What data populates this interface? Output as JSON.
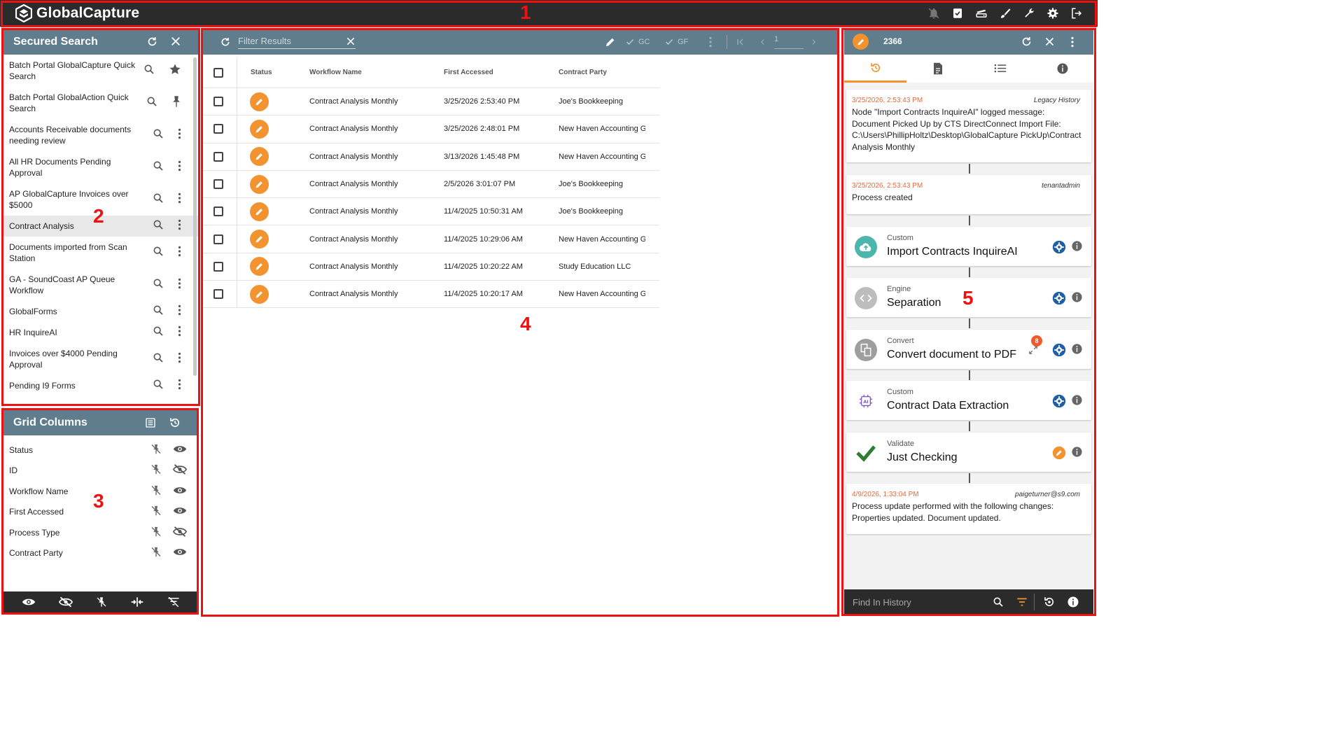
{
  "app": {
    "name": "GlobalCapture"
  },
  "callouts": [
    "1",
    "2",
    "3",
    "4",
    "5"
  ],
  "colors": {
    "topbar": "#2b2b2b",
    "header": "#5f7d8d",
    "accent": "#f2932f",
    "annotation": "#ee1111",
    "date": "#e56a3b"
  },
  "secured_search": {
    "title": "Secured Search",
    "items": [
      {
        "label": "Batch Portal GlobalCapture Quick Search",
        "action": "star-icon"
      },
      {
        "label": "Batch Portal GlobalAction Quick Search",
        "action": "pin-icon"
      },
      {
        "label": "Accounts Receivable documents needing review",
        "action": "more-icon"
      },
      {
        "label": "All HR Documents Pending Approval",
        "action": "more-icon"
      },
      {
        "label": "AP GlobalCapture Invoices over $5000",
        "action": "more-icon"
      },
      {
        "label": "Contract Analysis",
        "action": "more-icon",
        "selected": true
      },
      {
        "label": "Documents imported from Scan Station",
        "action": "more-icon"
      },
      {
        "label": "GA - SoundCoast AP Queue Workflow",
        "action": "more-icon"
      },
      {
        "label": "GlobalForms",
        "action": "more-icon"
      },
      {
        "label": "HR InquireAI",
        "action": "more-icon"
      },
      {
        "label": "Invoices over $4000 Pending Approval",
        "action": "more-icon"
      },
      {
        "label": "Pending I9 Forms",
        "action": "more-icon"
      }
    ]
  },
  "grid_columns": {
    "title": "Grid Columns",
    "columns": [
      {
        "label": "Status",
        "visible": true
      },
      {
        "label": "ID",
        "visible": false
      },
      {
        "label": "Workflow Name",
        "visible": true
      },
      {
        "label": "First Accessed",
        "visible": true
      },
      {
        "label": "Process Type",
        "visible": false
      },
      {
        "label": "Contract Party",
        "visible": true
      }
    ]
  },
  "grid": {
    "filter_placeholder": "Filter Results",
    "gc_label": "GC",
    "gf_label": "GF",
    "page": "1",
    "headers": {
      "status": "Status",
      "workflow": "Workflow Name",
      "first_accessed": "First Accessed",
      "party": "Contract Party"
    },
    "rows": [
      {
        "workflow": "Contract Analysis Monthly",
        "first_accessed": "3/25/2026 2:53:40 PM",
        "party": "Joe's Bookkeeping"
      },
      {
        "workflow": "Contract Analysis Monthly",
        "first_accessed": "3/25/2026 2:48:01 PM",
        "party": "New Haven Accounting Gr"
      },
      {
        "workflow": "Contract Analysis Monthly",
        "first_accessed": "3/13/2026 1:45:48 PM",
        "party": "New Haven Accounting Gr"
      },
      {
        "workflow": "Contract Analysis Monthly",
        "first_accessed": "2/5/2026 3:01:07 PM",
        "party": "Joe's Bookkeeping"
      },
      {
        "workflow": "Contract Analysis Monthly",
        "first_accessed": "11/4/2025 10:50:31 AM",
        "party": "Joe's Bookkeeping"
      },
      {
        "workflow": "Contract Analysis Monthly",
        "first_accessed": "11/4/2025 10:29:06 AM",
        "party": "New Haven Accounting Gr"
      },
      {
        "workflow": "Contract Analysis Monthly",
        "first_accessed": "11/4/2025 10:20:22 AM",
        "party": "Study Education LLC"
      },
      {
        "workflow": "Contract Analysis Monthly",
        "first_accessed": "11/4/2025 10:20:17 AM",
        "party": "New Haven Accounting Gr"
      }
    ]
  },
  "detail": {
    "id": "2366",
    "history": [
      {
        "date": "3/25/2026, 2:53:43 PM",
        "user": "Legacy History",
        "message": "Node \"Import Contracts InquireAI\" logged message: Document Picked Up by CTS DirectConnect Import File: C:\\Users\\PhillipHoltz\\Desktop\\GlobalCapture PickUp\\Contract Analysis Monthly"
      },
      {
        "date": "3/25/2026, 2:53:43 PM",
        "user": "tenantadmin",
        "message": "Process created"
      }
    ],
    "nodes": [
      {
        "type": "Custom",
        "name": "Import Contracts InquireAI",
        "icon": "cloud-upload-icon",
        "color": "#4db6ac"
      },
      {
        "type": "Engine",
        "name": "Separation",
        "icon": "code-icon",
        "color": "#bdbdbd"
      },
      {
        "type": "Convert",
        "name": "Convert document to PDF",
        "icon": "convert-doc-icon",
        "color": "#9e9e9e",
        "badge": "8"
      },
      {
        "type": "Custom",
        "name": "Contract Data Extraction",
        "icon": "ai-chip-icon",
        "color": "#b39ddb"
      },
      {
        "type": "Validate",
        "name": "Just Checking",
        "icon": "check-icon",
        "color": "#2e7d32"
      }
    ],
    "final": {
      "date": "4/9/2026, 1:33:04 PM",
      "user": "paigeturner@s9.com",
      "message": "Process update performed with the following changes: Properties updated. Document updated."
    },
    "find_placeholder": "Find In History"
  }
}
